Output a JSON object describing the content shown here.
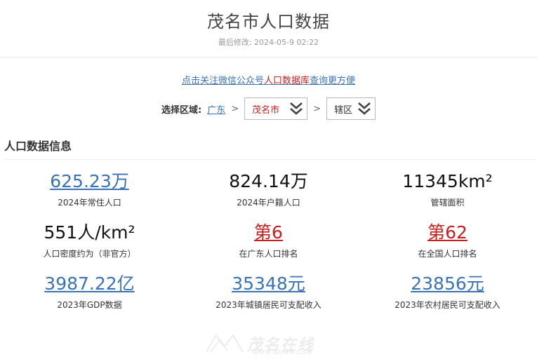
{
  "header": {
    "title": "茂名市人口数据",
    "modified": "最后修改: 2024-05-9 02:22"
  },
  "promo": {
    "prefix": "点击关注微信公众号",
    "highlight": "人口数据库",
    "suffix": "查询更方便"
  },
  "region": {
    "label": "选择区域:",
    "province": "广东",
    "separator": ">",
    "city_select": "茂名市",
    "district_select": "辖区"
  },
  "section": {
    "title": "人口数据信息"
  },
  "stats": [
    {
      "value": "625.23万",
      "caption": "2024年常住人口",
      "style": "link"
    },
    {
      "value": "824.14万",
      "caption": "2024年户籍人口",
      "style": "plain"
    },
    {
      "value": "11345km²",
      "caption": "管辖面积",
      "style": "plain"
    },
    {
      "value": "551人/km²",
      "caption": "人口密度约为（非官方）",
      "style": "plain"
    },
    {
      "value": "第6",
      "caption": "在广东人口排名",
      "style": "red"
    },
    {
      "value": "第62",
      "caption": "在全国人口排名",
      "style": "red"
    },
    {
      "value": "3987.22亿",
      "caption": "2023年GDP数据",
      "style": "link"
    },
    {
      "value": "35348元",
      "caption": "2023年城镇居民可支配收入",
      "style": "link"
    },
    {
      "value": "23856元",
      "caption": "2023年农村居民可支配收入",
      "style": "link"
    }
  ],
  "watermark": {
    "text": "茂名在线",
    "url": "WWW.GDMM.COM"
  },
  "colors": {
    "link": "#3a72b8",
    "accent_red": "#c81e1e",
    "text": "#333333"
  }
}
